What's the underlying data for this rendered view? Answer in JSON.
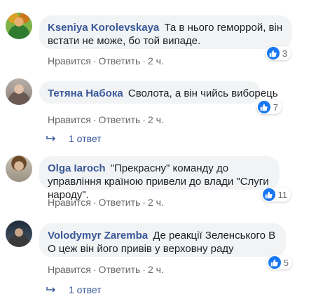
{
  "comments": [
    {
      "author": "Kseniya Korolevskaya",
      "text": "Та в нього геморрой, він встати не може, бо той випаде.",
      "reactions": "3",
      "like_label": "Нравится",
      "reply_label": "Ответить",
      "time": "2 ч."
    },
    {
      "author": "Тетяна Набока",
      "text": "Сволота, а він чийсь виборець",
      "reactions": "7",
      "like_label": "Нравится",
      "reply_label": "Ответить",
      "time": "2 ч.",
      "replies": "1 ответ"
    },
    {
      "author": "Olga Iaroch",
      "text": "\"Прекрасну\" команду до управління країною привели до влади \"Слуги народу\".",
      "reactions": "11",
      "like_label": "Нравится",
      "reply_label": "Ответить",
      "time": "2 ч."
    },
    {
      "author": "Volodymyr Zaremba",
      "text": "Де реакції Зеленського В О цеж він його привів у верховну раду",
      "reactions": "5",
      "like_label": "Нравится",
      "reply_label": "Ответить",
      "time": "2 ч.",
      "replies": "1 ответ"
    }
  ],
  "colors": {
    "author": "#385898",
    "bubble": "#f2f3f5",
    "meta": "#65676b",
    "like": "#1877f2"
  },
  "icons": [
    "thumbs-up-icon",
    "reply-arrow-icon"
  ]
}
